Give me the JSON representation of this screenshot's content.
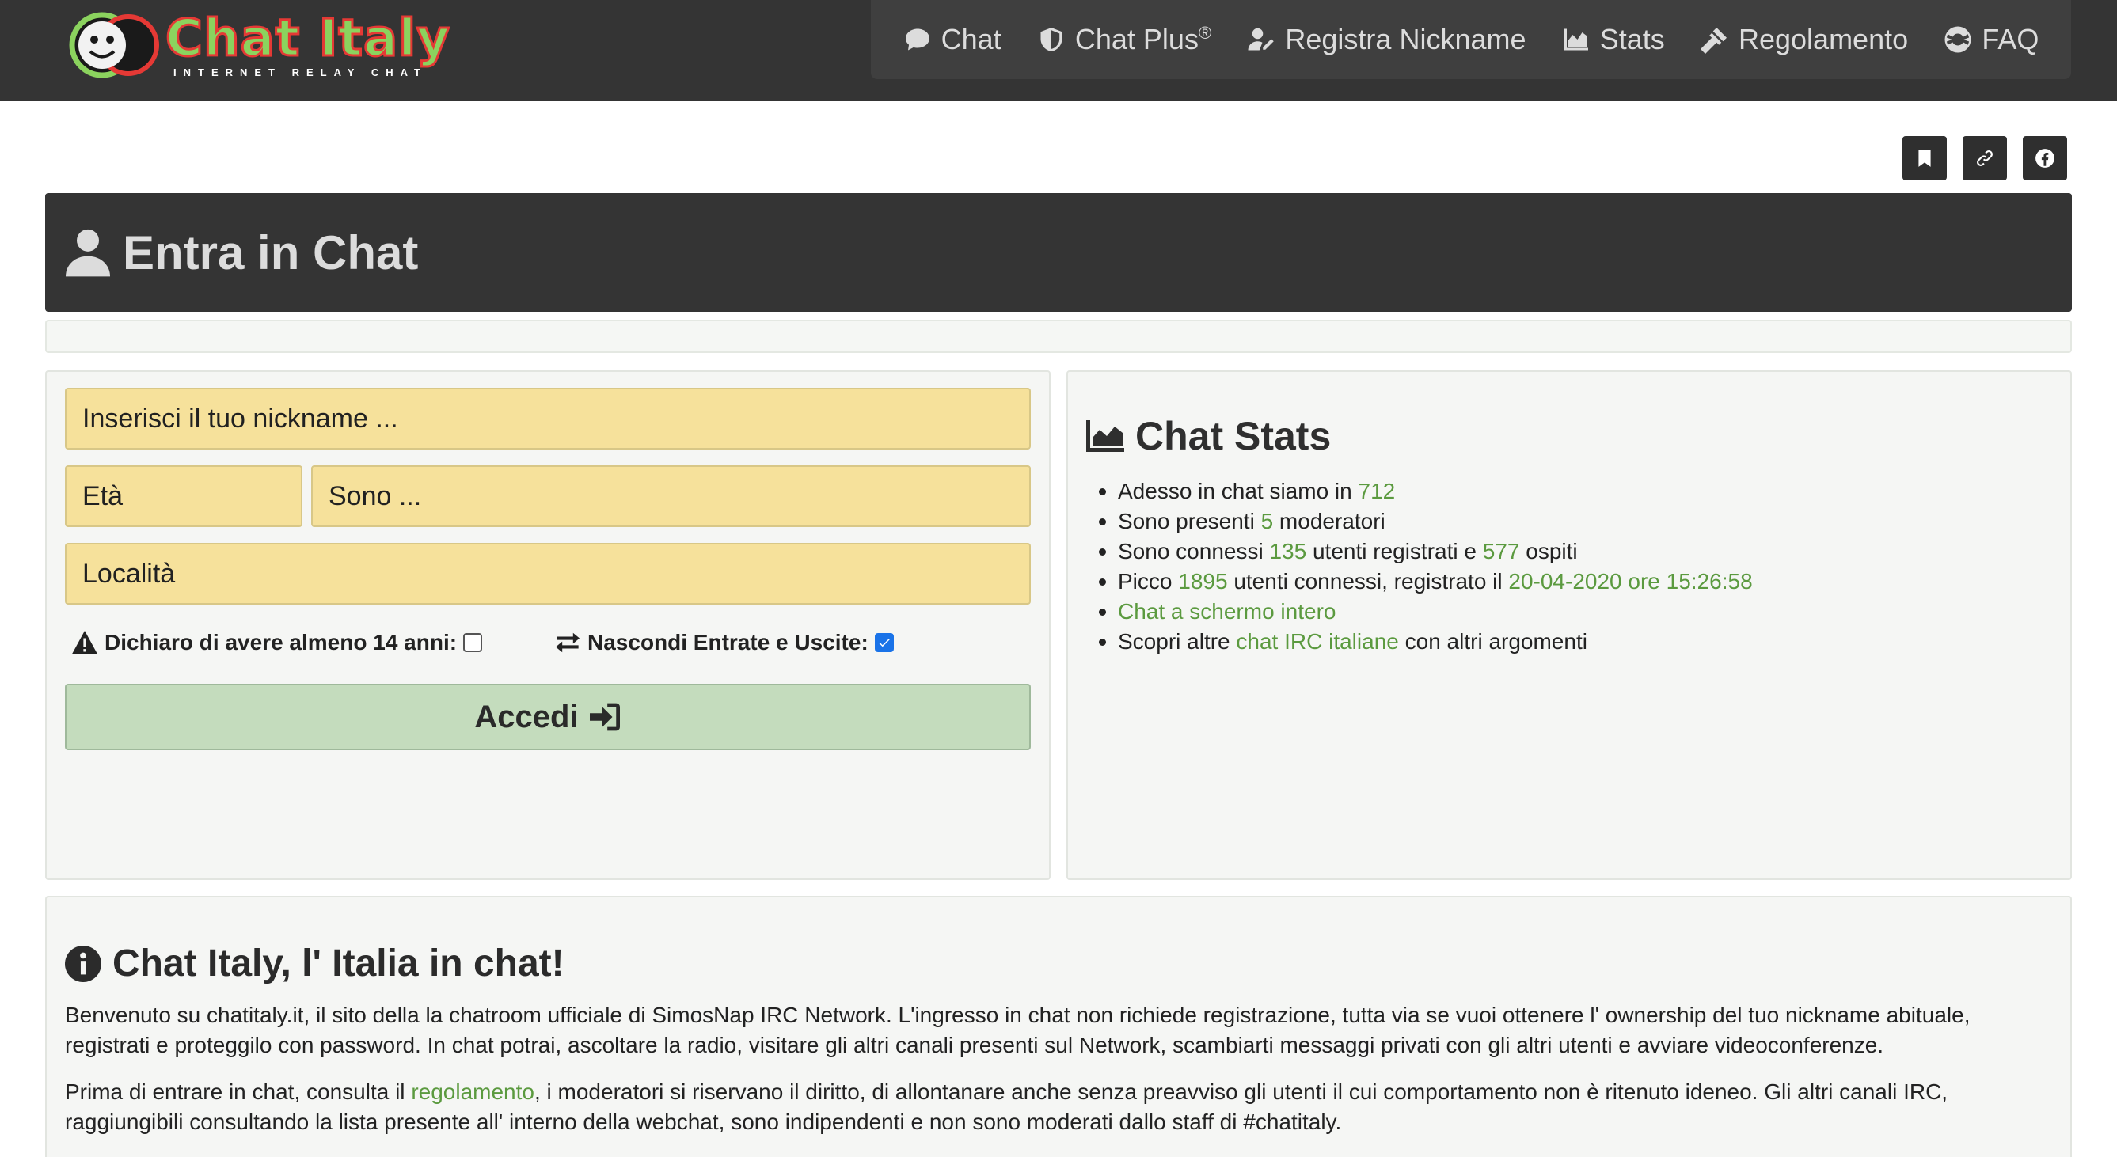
{
  "brand": {
    "name": "Chat Italy",
    "tagline": "INTERNET RELAY CHAT"
  },
  "nav": [
    {
      "label": "Chat",
      "icon": "comment-icon"
    },
    {
      "label": "Chat Plus",
      "sup": "®",
      "icon": "shield-icon"
    },
    {
      "label": "Registra Nickname",
      "icon": "user-edit-icon"
    },
    {
      "label": "Stats",
      "icon": "chart-area-icon"
    },
    {
      "label": "Regolamento",
      "icon": "gavel-icon"
    },
    {
      "label": "FAQ",
      "icon": "life-ring-icon"
    }
  ],
  "share_icons": [
    "bookmark-icon",
    "link-icon",
    "facebook-icon"
  ],
  "page_title": "Entra in Chat",
  "form": {
    "nickname_placeholder": "Inserisci il tuo nickname ...",
    "age_placeholder": "Età",
    "sono_placeholder": "Sono ...",
    "location_placeholder": "Località",
    "age_check_label": "Dichiaro di avere almeno 14 anni:",
    "age_checked": false,
    "hide_label": "Nascondi Entrate e Uscite:",
    "hide_checked": true,
    "submit_label": "Accedi"
  },
  "stats": {
    "title": "Chat Stats",
    "line1_pre": "Adesso in chat siamo in ",
    "users_total": "712",
    "line2_pre": "Sono presenti ",
    "moderators": "5",
    "line2_post": " moderatori",
    "line3_pre": "Sono connessi ",
    "registered": "135",
    "line3_mid": " utenti registrati e ",
    "guests": "577",
    "line3_post": " ospiti",
    "line4_pre": "Picco ",
    "peak": "1895",
    "line4_mid": " utenti connessi, registrato il ",
    "peak_date": "20-04-2020 ore 15:26:58",
    "fullscreen_link": "Chat a schermo intero",
    "line6_pre": "Scopri altre ",
    "irc_link": "chat IRC italiane",
    "line6_post": " con altri argomenti"
  },
  "info": {
    "title": "Chat Italy, l' Italia in chat!",
    "p1": "Benvenuto su chatitaly.it, il sito della la chatroom ufficiale di SimosNap IRC Network. L'ingresso in chat non richiede registrazione, tutta via se vuoi ottenere l' ownership del tuo nickname abituale, registrati e proteggilo con password. In chat potrai, ascoltare la radio, visitare gli altri canali presenti sul Network, scambiarti messaggi privati con gli altri utenti e avviare videoconferenze.",
    "p2_pre": "Prima di entrare in chat, consulta il ",
    "p2_link": "regolamento",
    "p2_post": ", i moderatori si riservano il diritto, di allontanare anche senza preavviso gli utenti il cui comportamento non è ritenuto ideneo. Gli altri canali IRC, raggiungibili consultando la lista presente all' interno della webchat, sono indipendenti e non sono moderati dallo staff di #chatitaly."
  }
}
